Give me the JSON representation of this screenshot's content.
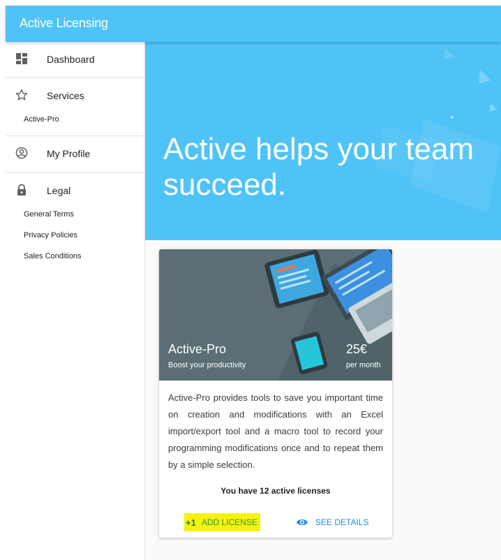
{
  "app": {
    "title": "Active Licensing"
  },
  "sidebar": {
    "items": [
      {
        "label": "Dashboard",
        "icon": "dashboard-icon"
      },
      {
        "label": "Services",
        "icon": "star-outline-icon",
        "subitems": [
          "Active-Pro"
        ]
      },
      {
        "label": "My Profile",
        "icon": "account-circle-icon"
      },
      {
        "label": "Legal",
        "icon": "lock-icon",
        "subitems": [
          "General Terms",
          "Privacy Policies",
          "Sales Conditions"
        ]
      }
    ]
  },
  "hero": {
    "headline": "Active helps your team succeed."
  },
  "card": {
    "title": "Active-Pro",
    "subtitle": "Boost your productivity",
    "price": "25€",
    "price_period": "per month",
    "description": "Active-Pro provides tools to save you important time on creation and modifications with an Excel import/export tool and a macro tool to record your programming modifications once and to repeat them by a simple selection.",
    "license_status": "You have 12 active licenses",
    "actions": {
      "add_license": {
        "icon_text": "+1",
        "label": "ADD LICENSE"
      },
      "see_details": {
        "icon": "eye-icon",
        "label": "SEE DETAILS"
      }
    }
  },
  "colors": {
    "primary": "#4fc3f7",
    "details_button": "#1e88e5",
    "highlight": "#f7f20b",
    "add_license_text": "#2a9a3c"
  }
}
